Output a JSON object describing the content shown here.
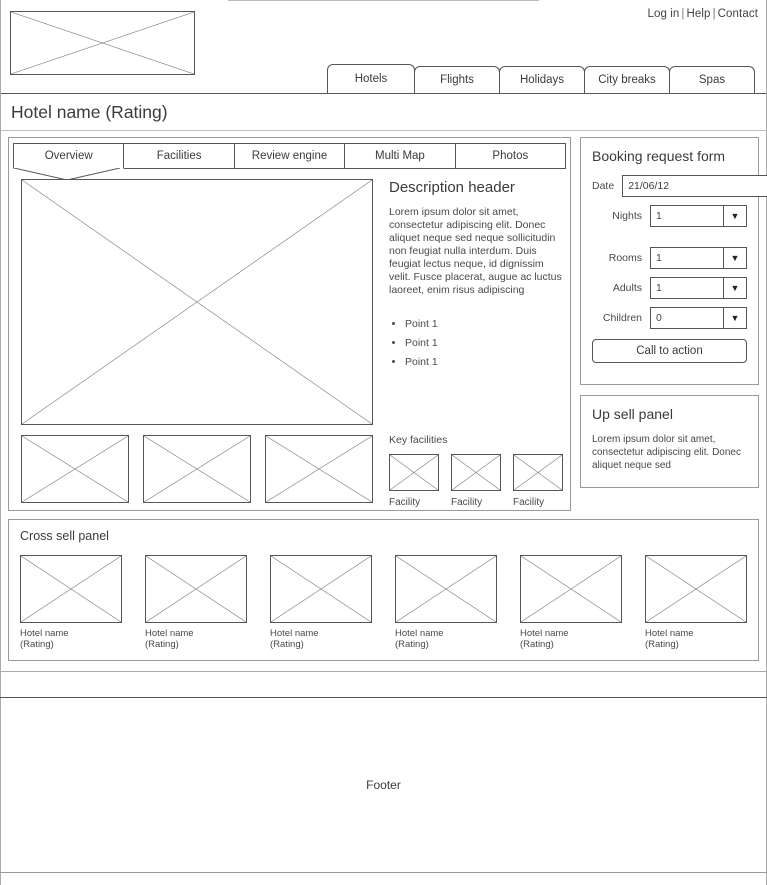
{
  "header": {
    "logo_alt": "logo-placeholder",
    "util_links": [
      "Log in",
      "Help",
      "Contact"
    ],
    "util_separator": "|",
    "nav_tabs": [
      {
        "label": "Hotels",
        "active": true,
        "width": 88
      },
      {
        "label": "Flights",
        "active": false,
        "width": 86
      },
      {
        "label": "Holidays",
        "active": false,
        "width": 86
      },
      {
        "label": "City breaks",
        "active": false,
        "width": 86
      },
      {
        "label": "Spas",
        "active": false,
        "width": 86
      }
    ]
  },
  "title_bar": {
    "page_title": "Hotel name (Rating)"
  },
  "content": {
    "subtabs": [
      {
        "label": "Overview",
        "active": true
      },
      {
        "label": "Facilities",
        "active": false
      },
      {
        "label": "Review engine",
        "active": false
      },
      {
        "label": "Multi Map",
        "active": false
      },
      {
        "label": "Photos",
        "active": false
      }
    ],
    "hero_alt": "hero-image-placeholder",
    "thumbnails": [
      {
        "alt": "thumbnail-1"
      },
      {
        "alt": "thumbnail-2"
      },
      {
        "alt": "thumbnail-3"
      }
    ],
    "description": {
      "header": "Description header",
      "body": "Lorem ipsum dolor sit amet, consectetur adipiscing elit. Donec aliquet neque sed neque sollicitudin non feugiat nulla interdum. Duis feugiat lectus neque, id dignissim velit. Fusce placerat, augue ac luctus laoreet, enim risus adipiscing",
      "points": [
        "Point 1",
        "Point 1",
        "Point 1"
      ]
    },
    "key_facilities": {
      "title": "Key facilities",
      "items": [
        {
          "label": "Facility"
        },
        {
          "label": "Facility"
        },
        {
          "label": "Facility"
        }
      ]
    }
  },
  "booking_form": {
    "title": "Booking request form",
    "fields": [
      {
        "label": "Date",
        "type": "text",
        "value": "21/06/12"
      },
      {
        "label": "Nights",
        "type": "select",
        "value": "1"
      },
      {
        "label": "Rooms",
        "type": "select",
        "value": "1"
      },
      {
        "label": "Adults",
        "type": "select",
        "value": "1"
      },
      {
        "label": "Children",
        "type": "select",
        "value": "0"
      }
    ],
    "dropdown_icon": "chevron-down-icon",
    "dropdown_glyph": "▼",
    "cta_label": "Call to action"
  },
  "upsell_panel": {
    "title": "Up sell panel",
    "text": "Lorem ipsum dolor sit amet, consectetur adipiscing elit. Donec aliquet neque sed"
  },
  "cross_sell": {
    "title": "Cross sell panel",
    "items": [
      {
        "name": "Hotel name",
        "rating": "(Rating)",
        "alt": "hotel-thumbnail-1"
      },
      {
        "name": "Hotel name",
        "rating": "(Rating)",
        "alt": "hotel-thumbnail-2"
      },
      {
        "name": "Hotel name",
        "rating": "(Rating)",
        "alt": "hotel-thumbnail-3"
      },
      {
        "name": "Hotel name",
        "rating": "(Rating)",
        "alt": "hotel-thumbnail-4"
      },
      {
        "name": "Hotel name",
        "rating": "(Rating)",
        "alt": "hotel-thumbnail-5"
      },
      {
        "name": "Hotel name",
        "rating": "(Rating)",
        "alt": "hotel-thumbnail-6"
      }
    ]
  },
  "footer": {
    "label": "Footer"
  },
  "colors": {
    "line": "#555555",
    "panel_border": "#9a9a9a",
    "text": "#3b3b3b",
    "muted_text": "#4a4a4a",
    "background": "#ffffff"
  }
}
